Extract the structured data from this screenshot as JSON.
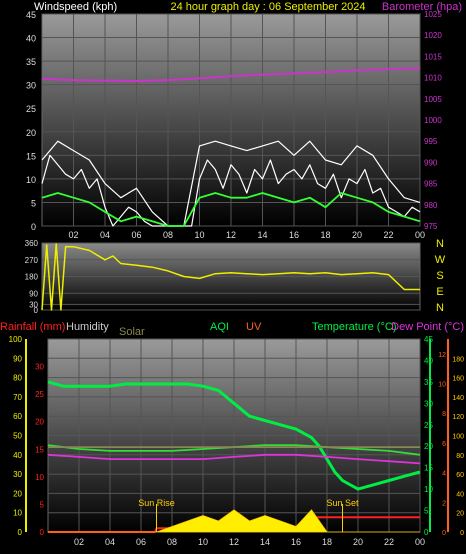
{
  "chart_data": [
    {
      "type": "line",
      "title": "24 hour graph day : 06 September 2024",
      "left_axis_label": "Windspeed (kph)",
      "right_axis_label": "Barometer (hpa)",
      "x_ticks": [
        "02",
        "04",
        "06",
        "08",
        "10",
        "12",
        "14",
        "16",
        "18",
        "20",
        "22",
        "00"
      ],
      "x_range_hours": [
        0,
        24
      ],
      "left_ylim": [
        0,
        45
      ],
      "left_ticks": [
        0,
        5,
        10,
        15,
        20,
        25,
        30,
        35,
        40,
        45
      ],
      "right_ylim": [
        975,
        1025
      ],
      "right_ticks": [
        975,
        980,
        985,
        990,
        995,
        1000,
        1005,
        1010,
        1015,
        1020,
        1025
      ],
      "grid": true,
      "series": [
        {
          "name": "Windspeed (kph)",
          "color": "#ffffff",
          "x": [
            0,
            0.5,
            1,
            1.5,
            2,
            2.5,
            3,
            3.5,
            4,
            4.5,
            5,
            5.5,
            6,
            6.5,
            7,
            7.5,
            8,
            8.5,
            9,
            9.5,
            10,
            10.5,
            11,
            11.5,
            12,
            12.5,
            13,
            13.5,
            14,
            14.5,
            15,
            15.5,
            16,
            16.5,
            17,
            17.5,
            18,
            18.5,
            19,
            19.5,
            20,
            20.5,
            21,
            21.5,
            22,
            22.5,
            23,
            23.5,
            24
          ],
          "values": [
            9,
            15,
            13,
            11,
            10,
            12,
            8,
            10,
            4,
            0,
            2,
            4,
            3,
            1,
            0,
            0,
            0,
            0,
            0,
            0,
            10,
            14,
            12,
            8,
            13,
            11,
            7,
            12,
            10,
            14,
            9,
            11,
            12,
            10,
            13,
            9,
            8,
            11,
            6,
            10,
            9,
            12,
            7,
            8,
            4,
            3,
            2,
            4,
            3
          ]
        },
        {
          "name": "Wind gust",
          "color": "#ffffff",
          "x": [
            0,
            1,
            2,
            3,
            4,
            5,
            6,
            7,
            8,
            9,
            10,
            11,
            12,
            13,
            14,
            15,
            16,
            17,
            18,
            19,
            20,
            21,
            22,
            23,
            24
          ],
          "values": [
            14,
            18,
            16,
            14,
            9,
            6,
            8,
            3,
            0,
            0,
            17,
            18,
            17,
            16,
            17,
            18,
            15,
            18,
            14,
            13,
            17,
            15,
            10,
            6,
            5
          ]
        },
        {
          "name": "Average wind",
          "color": "#33ff33",
          "x": [
            0,
            1,
            2,
            3,
            4,
            5,
            6,
            7,
            8,
            9,
            10,
            11,
            12,
            13,
            14,
            15,
            16,
            17,
            18,
            19,
            20,
            21,
            22,
            23,
            24
          ],
          "values": [
            6,
            7,
            6,
            5,
            3,
            1,
            2,
            1,
            0,
            0,
            6,
            7,
            6,
            6,
            7,
            6,
            5,
            6,
            4,
            7,
            6,
            5,
            3,
            2,
            1
          ]
        },
        {
          "name": "Barometer (hpa)",
          "color": "#cc33cc",
          "axis": "right",
          "x": [
            0,
            2,
            4,
            6,
            8,
            10,
            12,
            14,
            16,
            18,
            20,
            22,
            24
          ],
          "values": [
            1009.7,
            1009.4,
            1009.3,
            1009.2,
            1009.4,
            1009.8,
            1010.3,
            1010.7,
            1011.0,
            1011.3,
            1011.7,
            1012.0,
            1012.2
          ]
        }
      ]
    },
    {
      "type": "line",
      "left_ticks": [
        0,
        30,
        90,
        180,
        270,
        360
      ],
      "left_ylim": [
        0,
        360
      ],
      "x_range_hours": [
        0,
        24
      ],
      "direction_labels": [
        "N",
        "W",
        "S",
        "E",
        "N"
      ],
      "series": [
        {
          "name": "Wind direction",
          "color": "#eeee00",
          "x": [
            0,
            0.3,
            0.6,
            0.9,
            1.2,
            1.5,
            2,
            3,
            4,
            4.5,
            5,
            6,
            7,
            8,
            9,
            10,
            11,
            12,
            13,
            14,
            15,
            16,
            17,
            18,
            19,
            20,
            21,
            22,
            23,
            24
          ],
          "values": [
            0,
            350,
            0,
            355,
            0,
            340,
            340,
            320,
            270,
            290,
            250,
            240,
            230,
            210,
            180,
            170,
            195,
            200,
            195,
            190,
            195,
            200,
            195,
            200,
            190,
            195,
            200,
            190,
            110,
            110
          ]
        }
      ]
    },
    {
      "type": "line",
      "legend": [
        "Rainfall (mm)",
        "Humidity",
        "Solar",
        "AQI",
        "UV",
        "Temperature (°C)",
        "Dew Point (°C)"
      ],
      "x_ticks": [
        "02",
        "04",
        "06",
        "08",
        "10",
        "12",
        "14",
        "16",
        "18",
        "20",
        "22",
        "00"
      ],
      "x_range_hours": [
        0,
        24
      ],
      "humidity_ticks": [
        0,
        10,
        20,
        30,
        40,
        50,
        60,
        70,
        80,
        90,
        100
      ],
      "humidity_ylim": [
        0,
        100
      ],
      "rain_ticks": [
        0,
        5,
        10,
        15,
        20,
        25,
        30
      ],
      "rain_ylim": [
        0,
        35
      ],
      "temp_ticks": [
        0,
        5,
        10,
        15,
        20,
        25,
        30,
        35,
        40,
        45
      ],
      "temp_ylim": [
        0,
        45
      ],
      "solar_ticks": [
        0,
        20,
        40,
        60,
        80,
        100,
        120,
        140,
        160,
        180
      ],
      "solar_ylim": [
        0,
        200
      ],
      "uv_ticks": [
        0,
        2,
        4,
        6,
        8,
        10,
        12
      ],
      "uv_ylim": [
        0,
        13
      ],
      "annotations": [
        "Sun Rise",
        "Sun Set"
      ],
      "grid": true,
      "series": [
        {
          "name": "Temperature (°C)",
          "color": "#00ee44",
          "x": [
            0,
            1,
            2,
            3,
            4,
            5,
            6,
            7,
            8,
            9,
            10,
            11,
            12,
            13,
            14,
            15,
            16,
            17,
            17.5,
            18,
            18.5,
            19,
            20,
            21,
            22,
            23,
            24
          ],
          "values": [
            35,
            34,
            34,
            34,
            34,
            34.5,
            34.5,
            34.5,
            34.5,
            34.5,
            34,
            33,
            30,
            27,
            26,
            25,
            24,
            22,
            20,
            17,
            14,
            12,
            10,
            11,
            12,
            13,
            14
          ]
        },
        {
          "name": "Dew Point (°C)",
          "color": "#dd33dd",
          "x": [
            0,
            2,
            4,
            6,
            8,
            10,
            12,
            14,
            16,
            18,
            20,
            22,
            24
          ],
          "values": [
            18,
            17.5,
            17,
            17,
            17,
            17,
            17.5,
            18,
            18,
            17.5,
            17,
            16.5,
            16
          ]
        },
        {
          "name": "Humidity",
          "color": "#33dd33",
          "x": [
            0,
            2,
            4,
            6,
            8,
            10,
            12,
            14,
            16,
            18,
            20,
            22,
            24
          ],
          "values": [
            45,
            43,
            42,
            42,
            42,
            43,
            44,
            45,
            45,
            44,
            43,
            42,
            40
          ]
        },
        {
          "name": "Solar",
          "color": "#888855",
          "x": [
            0,
            4,
            8,
            12,
            16,
            20,
            24
          ],
          "values": [
            88,
            88,
            88,
            88,
            88,
            88,
            88
          ]
        },
        {
          "name": "UV",
          "color": "#ff2020",
          "x": [
            0,
            6.9,
            7,
            17,
            17.1,
            24
          ],
          "values": [
            0,
            0,
            0.25,
            0.25,
            1,
            1
          ]
        },
        {
          "name": "Rainfall (mm)",
          "color": "#ffee00",
          "x": [
            0,
            7,
            8,
            9,
            10,
            11,
            12,
            13,
            14,
            15,
            16,
            17,
            17.5,
            18,
            19,
            24
          ],
          "values": [
            0,
            0,
            1,
            2,
            3,
            2,
            4,
            2,
            3,
            2,
            1,
            4,
            2,
            0,
            0,
            0
          ]
        }
      ],
      "sun_rise_hour": 7,
      "sun_set_hour": 19
    }
  ],
  "side_labels": {
    "directions": [
      "N",
      "W",
      "S",
      "E",
      "N"
    ]
  },
  "colors": {
    "background": "#000000",
    "plot_top": "#909090",
    "plot_bottom": "#000000",
    "wind_label": "#ffffff",
    "title": "#eeee00",
    "baro_label": "#cc33cc",
    "rain_label": "#ff2020",
    "humidity_label": "#cccccc",
    "solar_label": "#888855",
    "aqi_label": "#00ee44",
    "uv_label": "#ff6020",
    "temp_label": "#00ee44",
    "dew_label": "#dd33dd"
  }
}
